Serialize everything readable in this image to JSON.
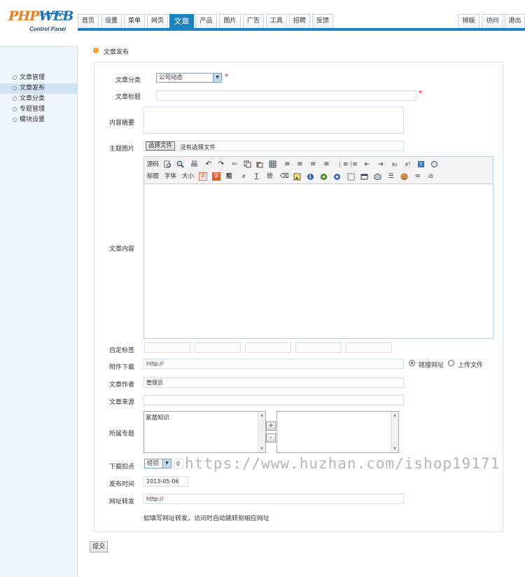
{
  "logo": {
    "brand_a": "PHP",
    "brand_b": "WEB",
    "sub": "Control Panel"
  },
  "topnav": {
    "tabs": [
      "首页",
      "设置",
      "菜单",
      "网页",
      "文章",
      "产品",
      "图片",
      "广告",
      "工具",
      "招聘",
      "反馈"
    ],
    "active": "文章",
    "right": [
      "排版",
      "访问",
      "退出"
    ]
  },
  "sidebar": {
    "items": [
      "文章管理",
      "文章发布",
      "文章分类",
      "专题管理",
      "模块设置"
    ],
    "active": "文章发布"
  },
  "breadcrumb": "文章发布",
  "form": {
    "category_label": "文章分类",
    "category_value": "公司动态",
    "title_label": "文章标题",
    "summary_label": "内容摘要",
    "image_label": "主题图片",
    "file_button": "选择文件",
    "file_status": "没有选择文件",
    "content_label": "文章内容",
    "toolbar_row1_text": [
      "源码"
    ],
    "toolbar_row2_text": [
      "标题",
      "字体",
      "大小",
      "字",
      "字",
      "粗"
    ],
    "tags_label": "自定标签",
    "attach_label": "附件下载",
    "attach_value": "http://",
    "radio_link": "链接网址",
    "radio_upload": "上传文件",
    "author_label": "文章作者",
    "author_value": "管理员",
    "source_label": "文章来源",
    "topic_label": "所属专题",
    "topic_option": "家居知识",
    "add_btn": "+",
    "remove_btn": "-",
    "points_label": "下载扣点",
    "points_type": "经验",
    "points_value": "0",
    "time_label": "发布时间",
    "time_value": "2013-05-06",
    "redirect_label": "网址转发",
    "redirect_value": "http://",
    "redirect_hint": "如填写网址转发，访问时自动跳转到相应网址",
    "submit": "提交"
  },
  "watermark": "https://www.huzhan.com/ishop19171",
  "colors": {
    "accent": "#1f82c0",
    "required": "#dd0000",
    "sidebar_bg": "#eef5fb"
  }
}
